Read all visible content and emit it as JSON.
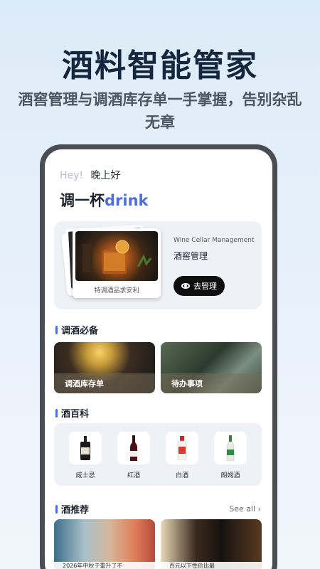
{
  "headline": "酒料智能管家",
  "subline": "酒窖管理与调酒库存单一手掌握，告别杂乱无章",
  "screen": {
    "greeting_hey": "Hey!",
    "greeting": "晚上好",
    "title_cn": "调一杯",
    "title_en": "drink",
    "wine_card": {
      "caption": "特调酒品求安利",
      "en_title": "Wine Cellar Management",
      "cn_title": "酒窖管理",
      "button_label": "去管理"
    },
    "essentials": {
      "title": "调酒必备",
      "tiles": [
        {
          "label": "调酒库存单"
        },
        {
          "label": "待办事项"
        }
      ]
    },
    "encyclopedia": {
      "title": "酒百科",
      "items": [
        {
          "name": "威士忌",
          "icon": "whiskey-bottle-icon"
        },
        {
          "name": "红酒",
          "icon": "red-wine-bottle-icon"
        },
        {
          "name": "白酒",
          "icon": "baijiu-bottle-icon"
        },
        {
          "name": "朗姆酒",
          "icon": "rum-bottle-icon"
        }
      ]
    },
    "recommend": {
      "title": "酒推荐",
      "see_all": "See all ›",
      "cards": [
        {
          "caption": "2026年中秋于重升了不"
        },
        {
          "caption": "百元以下性价比最"
        }
      ]
    }
  },
  "colors": {
    "accent": "#4e6fd8",
    "headline": "#15273f",
    "button": "#0f0f0f"
  }
}
